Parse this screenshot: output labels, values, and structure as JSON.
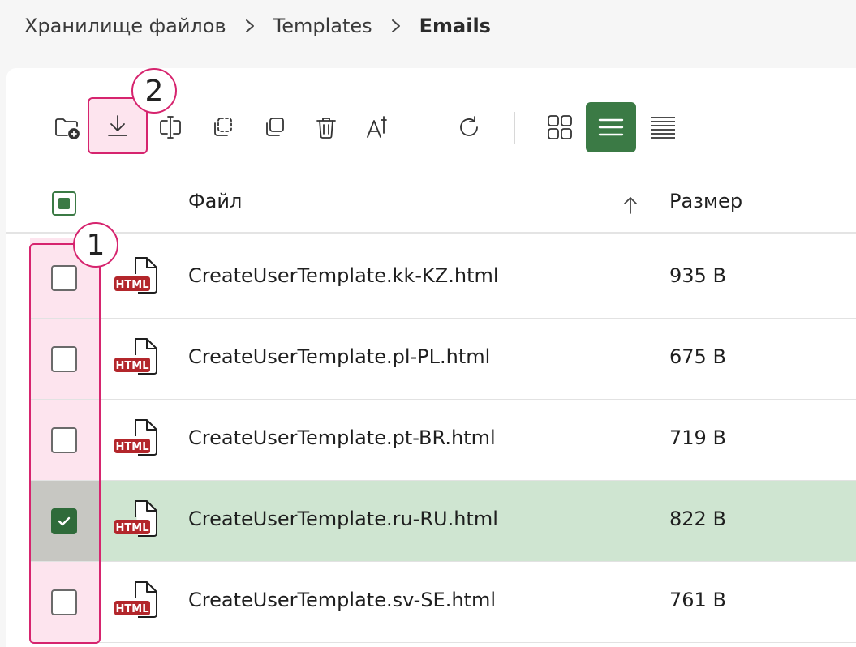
{
  "breadcrumb": {
    "items": [
      "Хранилище файлов",
      "Templates"
    ],
    "current": "Emails"
  },
  "toolbar": {
    "tools": [
      {
        "name": "new-folder",
        "icon": "folder-plus-icon"
      },
      {
        "name": "download",
        "icon": "download-icon"
      },
      {
        "name": "rename",
        "icon": "rename-icon"
      },
      {
        "name": "move",
        "icon": "move-icon"
      },
      {
        "name": "copy",
        "icon": "copy-icon"
      },
      {
        "name": "delete",
        "icon": "trash-icon"
      },
      {
        "name": "text-size",
        "icon": "text-size-icon"
      },
      {
        "name": "refresh",
        "icon": "refresh-icon"
      }
    ],
    "views": [
      {
        "name": "grid",
        "icon": "grid-view-icon",
        "active": false
      },
      {
        "name": "list",
        "icon": "list-view-icon",
        "active": true
      },
      {
        "name": "compact",
        "icon": "compact-list-icon",
        "active": false
      }
    ]
  },
  "callouts": {
    "first": "1",
    "second": "2"
  },
  "table": {
    "columns": {
      "file": "Файл",
      "size": "Размер"
    },
    "sort": "ascending",
    "rows": [
      {
        "name": "CreateUserTemplate.kk-KZ.html",
        "size": "935 B",
        "checked": false
      },
      {
        "name": "CreateUserTemplate.pl-PL.html",
        "size": "675 B",
        "checked": false
      },
      {
        "name": "CreateUserTemplate.pt-BR.html",
        "size": "719 B",
        "checked": false
      },
      {
        "name": "CreateUserTemplate.ru-RU.html",
        "size": "822 B",
        "checked": true
      },
      {
        "name": "CreateUserTemplate.sv-SE.html",
        "size": "761 B",
        "checked": false
      }
    ],
    "file_badge": "HTML"
  },
  "colors": {
    "accent": "#3b7a45",
    "highlight": "#d6246e",
    "selected_row": "#cfe5d1",
    "file_badge": "#b3262b"
  }
}
